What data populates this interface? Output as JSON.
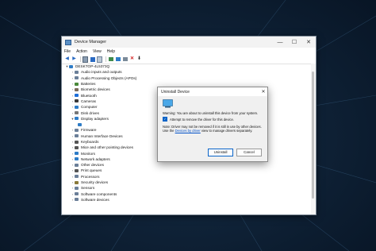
{
  "window": {
    "title": "Device Manager",
    "minimize": "—",
    "maximize": "☐",
    "close": "✕"
  },
  "menu": [
    "File",
    "Action",
    "View",
    "Help"
  ],
  "tree": {
    "root": "DESKTOP-4L5373Q",
    "categories": [
      {
        "label": "Audio inputs and outputs",
        "color": "#6b7f99"
      },
      {
        "label": "Audio Processing Objects (APOs)",
        "color": "#6b7f99"
      },
      {
        "label": "Batteries",
        "color": "#4a8a3a"
      },
      {
        "label": "Biometric devices",
        "color": "#7a6a5a"
      },
      {
        "label": "Bluetooth",
        "color": "#1e6fd9"
      },
      {
        "label": "Cameras",
        "color": "#3a3a3a"
      },
      {
        "label": "Computer",
        "color": "#2e7cc7"
      },
      {
        "label": "Disk drives",
        "color": "#777777"
      },
      {
        "label": "Display adapters",
        "color": "#2e7cc7",
        "expanded": true,
        "child": " "
      },
      {
        "label": "Firmware",
        "color": "#6b7f99"
      },
      {
        "label": "Human Interface Devices",
        "color": "#6b7f99"
      },
      {
        "label": "Keyboards",
        "color": "#555555"
      },
      {
        "label": "Mice and other pointing devices",
        "color": "#555555"
      },
      {
        "label": "Monitors",
        "color": "#2e7cc7"
      },
      {
        "label": "Network adapters",
        "color": "#2e7cc7"
      },
      {
        "label": "Other devices",
        "color": "#6b7f99"
      },
      {
        "label": "Print queues",
        "color": "#555555"
      },
      {
        "label": "Processors",
        "color": "#6b7f99"
      },
      {
        "label": "Security devices",
        "color": "#8a7a3a"
      },
      {
        "label": "Sensors",
        "color": "#6b7f99"
      },
      {
        "label": "Software components",
        "color": "#6b7f99"
      },
      {
        "label": "Software devices",
        "color": "#6b7f99"
      }
    ]
  },
  "dialog": {
    "title": "Uninstall Device",
    "close": "✕",
    "warning": "Warning: You are about to uninstall this device from your system.",
    "checkbox_label": "Attempt to remove the driver for this device.",
    "checkbox_checked": true,
    "note_before": "Note: Driver may not be removed if it is still in use by other devices. Use the ",
    "note_link": "Devices by driver",
    "note_after": " view to manage drivers separately.",
    "uninstall_label": "Uninstall",
    "cancel_label": "Cancel"
  },
  "colors": {
    "accent": "#0a64c8",
    "background": "#0f2237"
  }
}
